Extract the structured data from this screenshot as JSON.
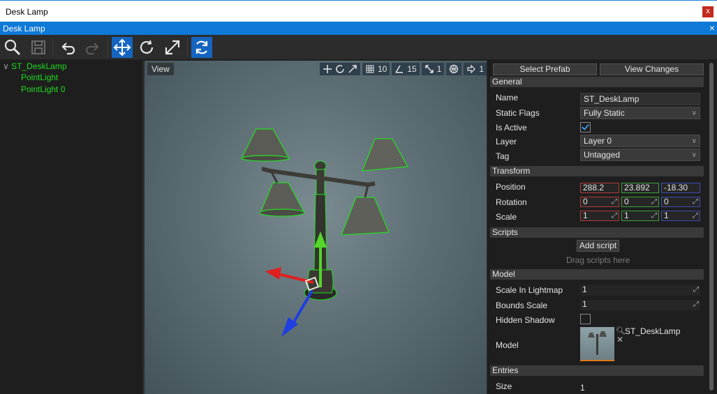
{
  "window": {
    "title": "Desk Lamp",
    "close_label": "x"
  },
  "tab": {
    "title": "Desk Lamp",
    "close_label": "×"
  },
  "toolbar": {
    "buttons": [
      "search-icon",
      "save-icon",
      "undo-icon",
      "redo-icon",
      "move-icon",
      "rotate-icon",
      "scale-icon",
      "refresh-icon"
    ],
    "active": [
      "move-icon",
      "refresh-icon"
    ]
  },
  "tree": {
    "root": "ST_DeskLamp",
    "children": [
      "PointLight",
      "PointLight 0"
    ]
  },
  "viewport": {
    "view_label": "View",
    "grid_snap": "10",
    "rotation_snap": "15",
    "scale_snap": "1",
    "camera_speed": "1"
  },
  "properties": {
    "select_prefab": "Select Prefab",
    "view_changes": "View Changes",
    "general": {
      "header": "General",
      "name_label": "Name",
      "name_value": "ST_DeskLamp",
      "static_flags_label": "Static Flags",
      "static_flags_value": "Fully Static",
      "is_active_label": "Is Active",
      "is_active": true,
      "layer_label": "Layer",
      "layer_value": "Layer 0",
      "tag_label": "Tag",
      "tag_value": "Untagged"
    },
    "transform": {
      "header": "Transform",
      "position_label": "Position",
      "position": [
        "288.2",
        "23.892",
        "-18.30"
      ],
      "rotation_label": "Rotation",
      "rotation": [
        "0",
        "0",
        "0"
      ],
      "scale_label": "Scale",
      "scale": [
        "1",
        "1",
        "1"
      ]
    },
    "scripts": {
      "header": "Scripts",
      "add_script": "Add script",
      "drag_hint": "Drag scripts here"
    },
    "model": {
      "header": "Model",
      "scale_in_lightmap_label": "Scale In Lightmap",
      "scale_in_lightmap": "1",
      "bounds_scale_label": "Bounds Scale",
      "bounds_scale": "1",
      "hidden_shadow_label": "Hidden Shadow",
      "hidden_shadow": false,
      "model_label": "Model",
      "model_asset": "ST_DeskLamp"
    },
    "entries": {
      "header": "Entries",
      "size_label": "Size",
      "size_value": "1"
    }
  },
  "colors": {
    "accent": "#0e79d6",
    "tree_text": "#1fdc1f",
    "axis_x": "#b33a3a",
    "axis_y": "#3aa33a",
    "axis_z": "#3a4db3"
  }
}
